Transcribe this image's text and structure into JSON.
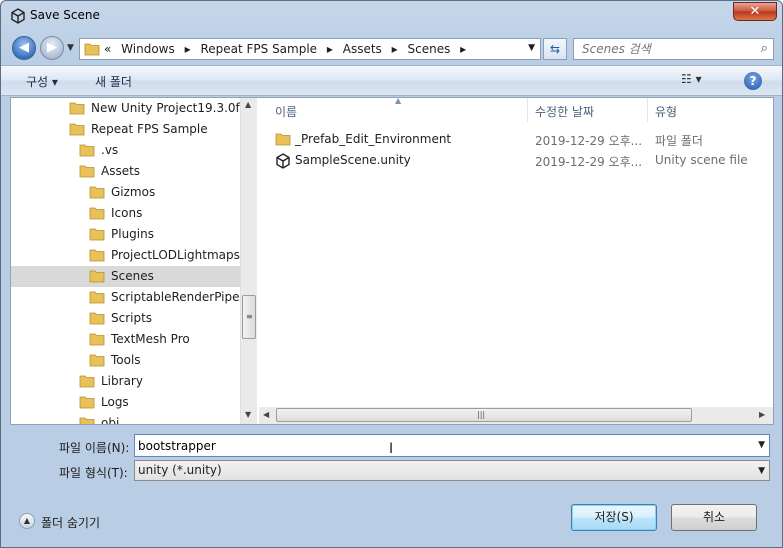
{
  "window": {
    "title": "Save Scene",
    "close_glyph": "✕"
  },
  "nav": {
    "back_glyph": "◀",
    "forward_glyph": "▶",
    "breadcrumb": [
      "«",
      "Windows",
      "▸",
      "Repeat FPS Sample",
      "▸",
      "Assets",
      "▸",
      "Scenes",
      "▸"
    ],
    "search_placeholder": "Scenes 검색"
  },
  "toolbar": {
    "organize": "구성 ▾",
    "new_folder": "새 폴더",
    "help": "?"
  },
  "tree": {
    "items": [
      {
        "label": "New Unity Project19.3.0f1",
        "indent": 0,
        "selected": false
      },
      {
        "label": "Repeat FPS Sample",
        "indent": 0,
        "selected": false
      },
      {
        "label": ".vs",
        "indent": 1,
        "selected": false
      },
      {
        "label": "Assets",
        "indent": 1,
        "selected": false
      },
      {
        "label": "Gizmos",
        "indent": 2,
        "selected": false
      },
      {
        "label": "Icons",
        "indent": 2,
        "selected": false
      },
      {
        "label": "Plugins",
        "indent": 2,
        "selected": false
      },
      {
        "label": "ProjectLODLightmaps",
        "indent": 2,
        "selected": false
      },
      {
        "label": "Scenes",
        "indent": 2,
        "selected": true
      },
      {
        "label": "ScriptableRenderPipeline",
        "indent": 2,
        "selected": false
      },
      {
        "label": "Scripts",
        "indent": 2,
        "selected": false
      },
      {
        "label": "TextMesh Pro",
        "indent": 2,
        "selected": false
      },
      {
        "label": "Tools",
        "indent": 2,
        "selected": false
      },
      {
        "label": "Library",
        "indent": 1,
        "selected": false
      },
      {
        "label": "Logs",
        "indent": 1,
        "selected": false
      },
      {
        "label": "obj",
        "indent": 1,
        "selected": false
      }
    ]
  },
  "files": {
    "columns": {
      "name": "이름",
      "date": "수정한 날짜",
      "type": "유형"
    },
    "rows": [
      {
        "name": "_Prefab_Edit_Environment",
        "date": "2019-12-29 오후...",
        "type": "파일 폴더",
        "icon": "folder-icon"
      },
      {
        "name": "SampleScene.unity",
        "date": "2019-12-29 오후...",
        "type": "Unity scene file",
        "icon": "unity-icon"
      }
    ]
  },
  "form": {
    "filename_label": "파일 이름(N):",
    "filename_value": "bootstrapper",
    "filetype_label": "파일 형식(T):",
    "filetype_value": "unity (*.unity)"
  },
  "footer": {
    "hide_folders": "폴더 숨기기",
    "save": "저장(S)",
    "cancel": "취소"
  },
  "colors": {
    "folder": "#e8c15a",
    "selection": "#d9d9d9",
    "accent": "#3c7fb1"
  }
}
